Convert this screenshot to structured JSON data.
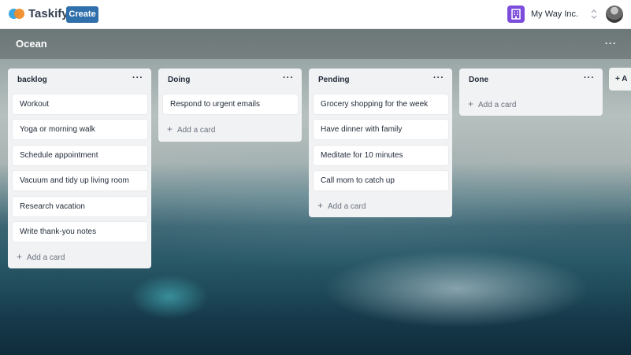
{
  "nav": {
    "brand": "Taskify",
    "create_label": "Create",
    "org_name": "My Way Inc."
  },
  "board": {
    "title": "Ocean",
    "more": "···",
    "add_list_label": "+ A"
  },
  "lists": [
    {
      "title": "backlog",
      "more": "···",
      "cards": [
        "Workout",
        "Yoga or morning walk",
        "Schedule appointment",
        "Vacuum and tidy up living room",
        "Research vacation",
        "Write thank-you notes"
      ],
      "add_label": "Add a card"
    },
    {
      "title": "Doing",
      "more": "···",
      "cards": [
        "Respond to urgent emails"
      ],
      "add_label": "Add a card"
    },
    {
      "title": "Pending",
      "more": "···",
      "cards": [
        "Grocery shopping for the week",
        "Have dinner with family",
        "Meditate for 10 minutes",
        "Call mom to catch up"
      ],
      "add_label": "Add a card"
    },
    {
      "title": "Done",
      "more": "···",
      "cards": [],
      "add_label": "Add a card"
    }
  ],
  "colors": {
    "create_button": "#2f6fab",
    "org_icon": "#7c4ddb",
    "list_bg": "#f1f2f4"
  },
  "icons": {
    "logo": "taskify-logo-icon",
    "org": "building-icon",
    "org_switch": "chevron-up-down-icon",
    "avatar": "user-avatar",
    "add": "plus-icon"
  }
}
